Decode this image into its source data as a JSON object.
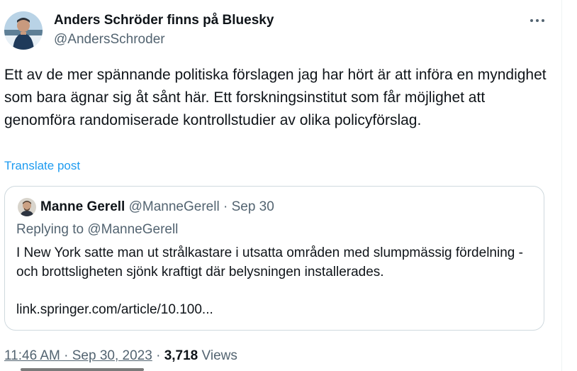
{
  "tweet": {
    "display_name": "Anders Schröder finns på Bluesky",
    "handle": "@AndersSchroder",
    "text": "Ett av de mer spännande politiska förslagen jag har hört är att införa en myndighet som bara ägnar sig åt sånt här. Ett forskningsinstitut som får möjlighet att genomföra randomiserade kontrollstudier av olika policyförslag.",
    "translate_label": "Translate post",
    "more_icon": "more-horizontal-icon"
  },
  "quote": {
    "name": "Manne Gerell",
    "handle": "@ManneGerell",
    "separator": " · ",
    "date": "Sep 30",
    "replying_to": "Replying to @ManneGerell",
    "text": "I New York satte man ut strålkastare i utsatta områden med slumpmässig fördelning - och brottsligheten sjönk kraftigt där belysningen installerades.",
    "link": "link.springer.com/article/10.100..."
  },
  "footer": {
    "timestamp": "11:46 AM · Sep 30, 2023",
    "separator": " · ",
    "views_count": "3,718",
    "views_label": " Views"
  }
}
